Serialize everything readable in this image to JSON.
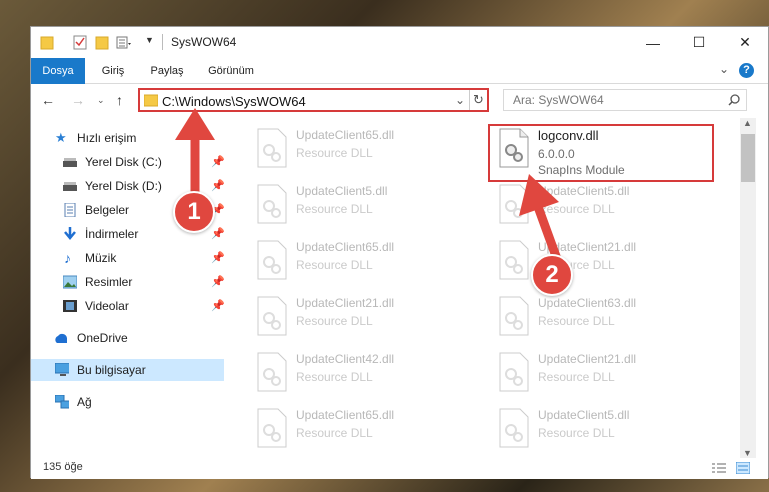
{
  "window": {
    "title": "SysWOW64",
    "controls": {
      "minimize": "—",
      "maximize": "☐",
      "close": "✕"
    }
  },
  "ribbon": {
    "tabs": [
      {
        "label": "Dosya",
        "active": true
      },
      {
        "label": "Giriş",
        "active": false
      },
      {
        "label": "Paylaş",
        "active": false
      },
      {
        "label": "Görünüm",
        "active": false
      }
    ],
    "expand": "⌄",
    "help": "?"
  },
  "address": {
    "path": "C:\\Windows\\SysWOW64",
    "search_placeholder": "Ara: SysWOW64"
  },
  "sidebar": {
    "items": [
      {
        "label": "Hızlı erişim",
        "icon": "star-icon",
        "pinned": false
      },
      {
        "label": "Yerel Disk (C:)",
        "icon": "drive-icon",
        "pinned": true
      },
      {
        "label": "Yerel Disk (D:)",
        "icon": "drive-icon",
        "pinned": true
      },
      {
        "label": "Belgeler",
        "icon": "document-icon",
        "pinned": true
      },
      {
        "label": "İndirmeler",
        "icon": "download-icon",
        "pinned": true
      },
      {
        "label": "Müzik",
        "icon": "music-icon",
        "pinned": true
      },
      {
        "label": "Resimler",
        "icon": "pictures-icon",
        "pinned": true
      },
      {
        "label": "Videolar",
        "icon": "video-icon",
        "pinned": true
      },
      {
        "label": "OneDrive",
        "icon": "cloud-icon",
        "pinned": false
      },
      {
        "label": "Bu bilgisayar",
        "icon": "computer-icon",
        "pinned": false,
        "selected": true
      },
      {
        "label": "Ağ",
        "icon": "network-icon",
        "pinned": false
      }
    ]
  },
  "files": {
    "left": [
      {
        "name": "UpdateClient65.dll",
        "desc": "Resource DLL"
      },
      {
        "name": "UpdateClient5.dll",
        "desc": "Resource DLL"
      },
      {
        "name": "UpdateClient65.dll",
        "desc": "Resource DLL"
      },
      {
        "name": "UpdateClient21.dll",
        "desc": "Resource DLL"
      },
      {
        "name": "UpdateClient42.dll",
        "desc": "Resource DLL"
      },
      {
        "name": "UpdateClient65.dll",
        "desc": "Resource DLL"
      }
    ],
    "right": [
      {
        "name": "UpdateClient5.dll",
        "desc": "Resource DLL"
      },
      {
        "name": "UpdateClient21.dll",
        "desc": "Resource DLL"
      },
      {
        "name": "UpdateClient63.dll",
        "desc": "Resource DLL"
      },
      {
        "name": "UpdateClient21.dll",
        "desc": "Resource DLL"
      },
      {
        "name": "UpdateClient5.dll",
        "desc": "Resource DLL"
      }
    ],
    "highlighted": {
      "name": "logconv.dll",
      "version": "6.0.0.0",
      "desc": "SnapIns Module"
    }
  },
  "status": {
    "count": "135 öğe"
  },
  "annotations": {
    "step1": "1",
    "step2": "2",
    "color": "#e0473f"
  }
}
